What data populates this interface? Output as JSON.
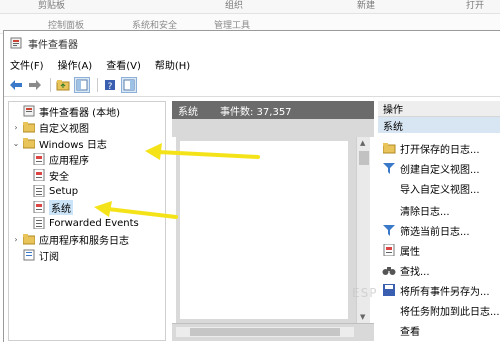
{
  "background": {
    "ribbon": [
      "剪贴板",
      "组织",
      "新建",
      "打开"
    ],
    "address": [
      "控制面板",
      "系统和安全",
      "管理工具"
    ]
  },
  "window": {
    "title": "事件查看器"
  },
  "menu": [
    "文件(F)",
    "操作(A)",
    "查看(V)",
    "帮助(H)"
  ],
  "tree": {
    "root": "事件查看器 (本地)",
    "custom_views": "自定义视图",
    "windows_logs": "Windows 日志",
    "application": "应用程序",
    "security": "安全",
    "setup": "Setup",
    "system": "系统",
    "forwarded": "Forwarded Events",
    "apps_services": "应用程序和服务日志",
    "subscriptions": "订阅"
  },
  "middle": {
    "title": "系统",
    "event_count": "事件数: 37,357"
  },
  "actions": {
    "header": "操作",
    "section": "系统",
    "items": [
      "打开保存的日志...",
      "创建自定义视图...",
      "导入自定义视图...",
      "清除日志...",
      "筛选当前日志...",
      "属性",
      "查找...",
      "将所有事件另存为...",
      "将任务附加到此日志...",
      "查看"
    ]
  },
  "watermark": "ESP"
}
